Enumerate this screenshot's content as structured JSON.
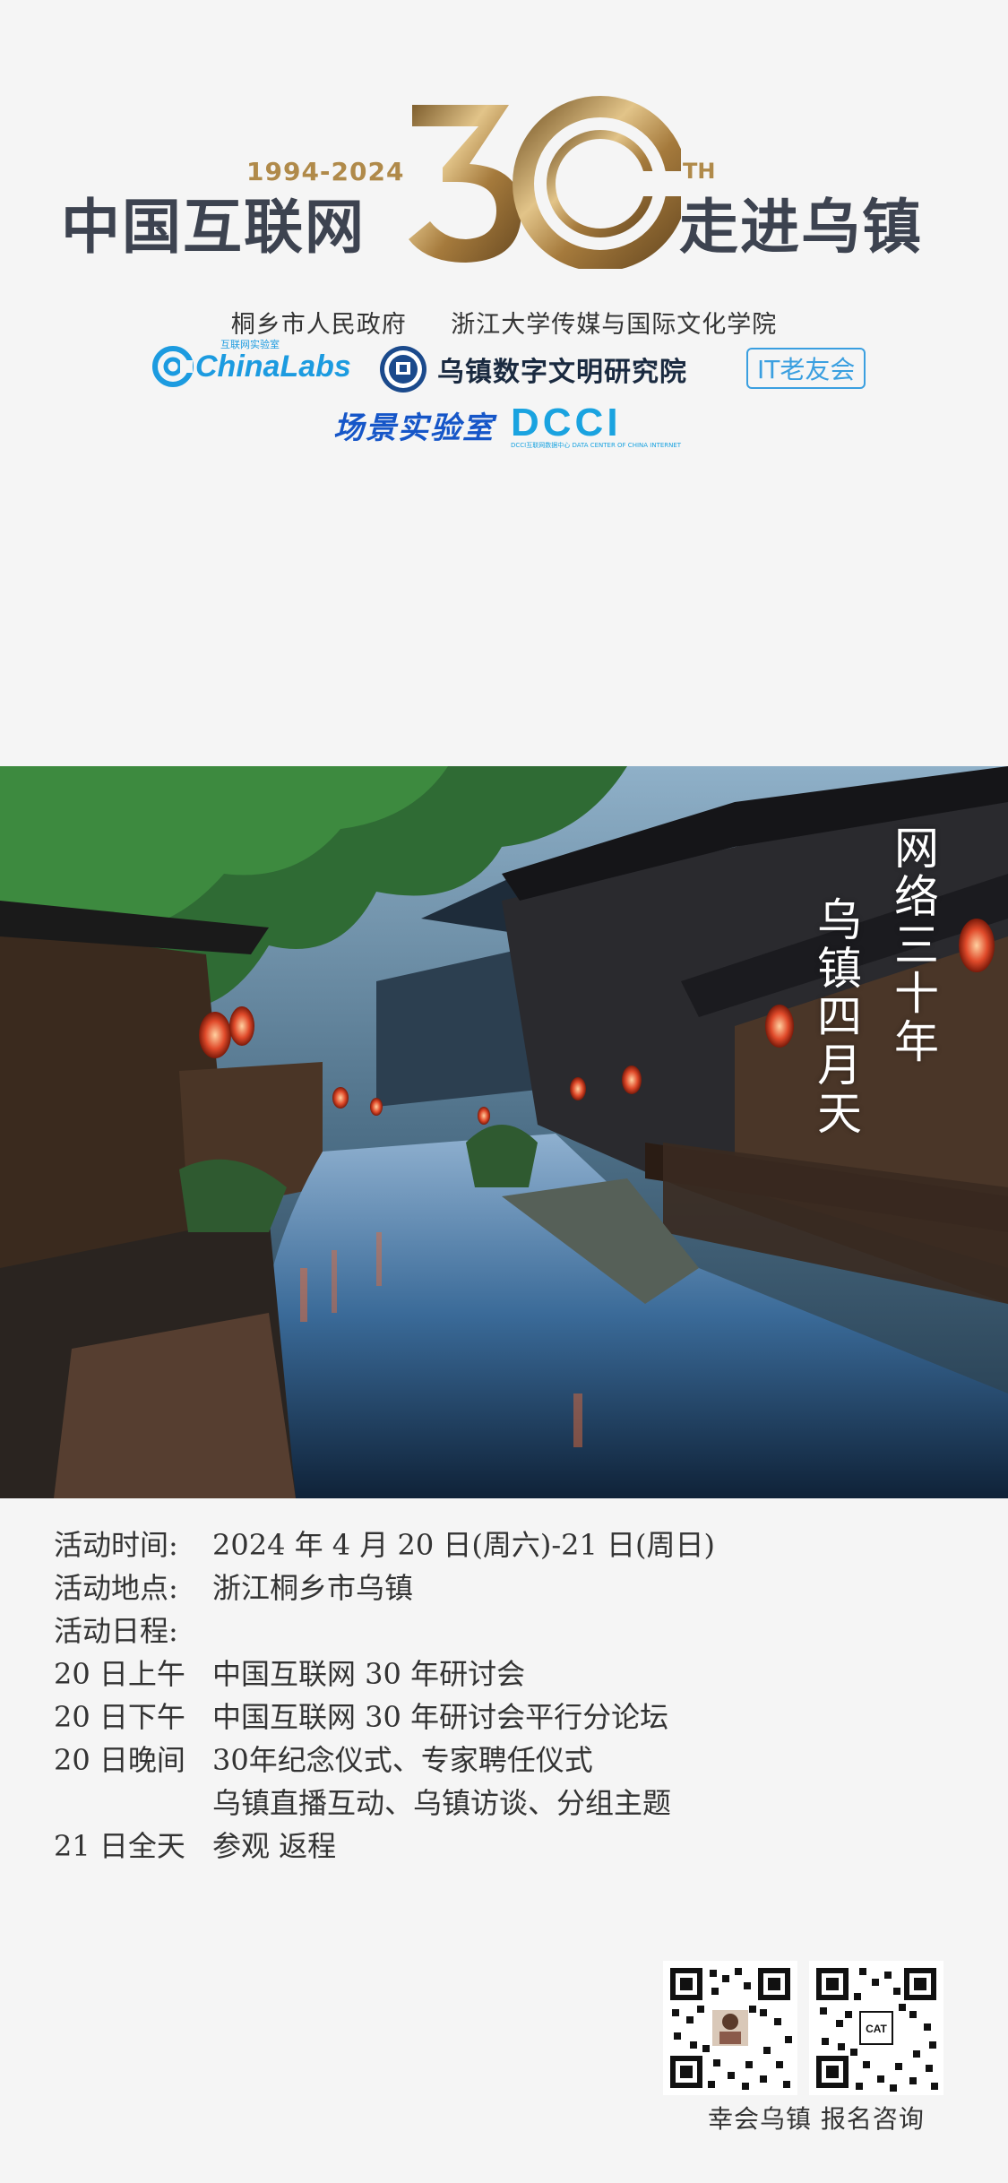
{
  "header": {
    "years": "1994-2024",
    "title_left": "中国互联网",
    "big_number": "30",
    "th": "TH",
    "title_right": "走进乌镇"
  },
  "organizers": {
    "line1": [
      "桐乡市人民政府",
      "浙江大学传媒与国际文化学院"
    ],
    "chinalabs": "ChinaLabs",
    "chinalabs_sub": "互联网实验室",
    "wuzhen_institute": "乌镇数字文明研究院",
    "itlao": "IT老友会",
    "changjing": "场景实验室",
    "dcci": "DCCI",
    "dcci_sub": "DCCI互联网数据中心 DATA CENTER OF CHINA INTERNET"
  },
  "photo": {
    "slogan_line1": "网络三十年",
    "slogan_line2": "乌镇四月天"
  },
  "event": {
    "time_label": "活动时间:",
    "time_value": "2024 年 4 月 20 日(周六)-21 日(周日)",
    "place_label": "活动地点:",
    "place_value": "浙江桐乡市乌镇",
    "schedule_label": "活动日程:",
    "schedule": [
      {
        "when": "20 日上午",
        "what": "中国互联网 30 年研讨会"
      },
      {
        "when": "20 日下午",
        "what": "中国互联网 30 年研讨会平行分论坛"
      },
      {
        "when": "20 日晚间",
        "what": "30年纪念仪式、专家聘任仪式"
      },
      {
        "when": "",
        "what": "乌镇直播互动、乌镇访谈、分组主题"
      },
      {
        "when": "21 日全天",
        "what": "参观 返程"
      }
    ]
  },
  "qr": {
    "caption": "幸会乌镇  报名咨询",
    "qr2_center": "CAT"
  },
  "colors": {
    "gold": "#b08a4a",
    "title_gray": "#3d4350",
    "chinalabs_blue": "#1c9be0",
    "changjing_blue": "#1656c8"
  }
}
